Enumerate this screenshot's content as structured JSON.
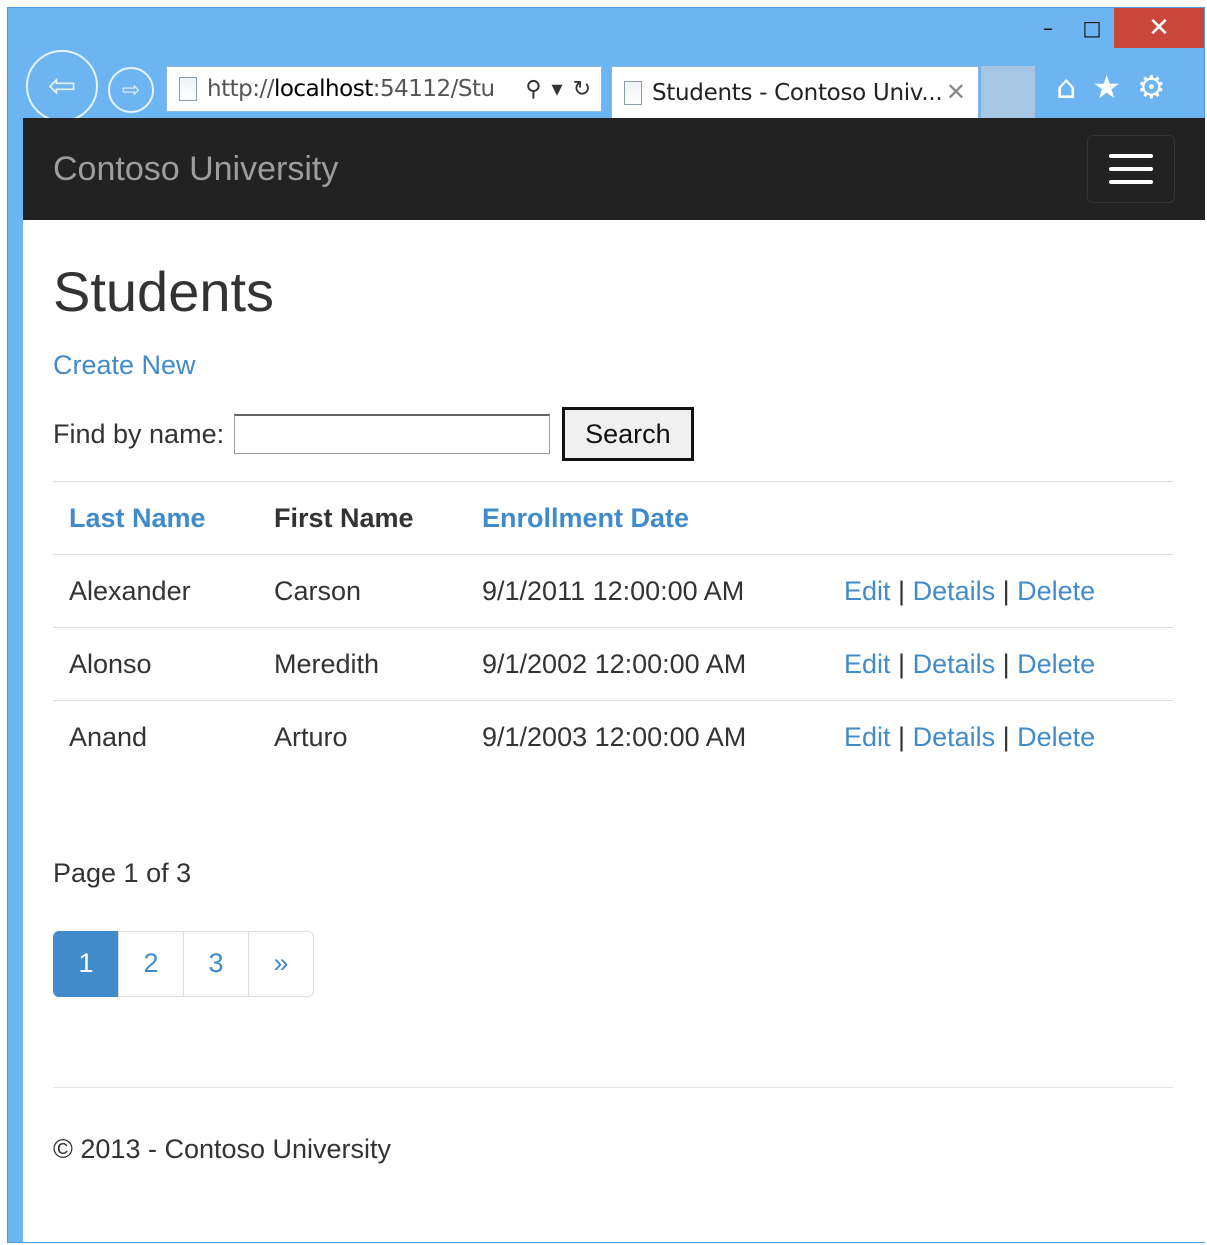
{
  "browser": {
    "url_prefix": "http://",
    "url_host": "localhost",
    "url_rest": ":54112/Stu",
    "tab_title": "Students - Contoso Univ...",
    "minimize": "–",
    "maximize": "□",
    "close": "✕",
    "tab_close": "✕"
  },
  "navbar": {
    "brand": "Contoso University"
  },
  "page": {
    "title": "Students",
    "create_new": "Create New",
    "find_label": "Find by name:",
    "search_value": "",
    "search_button": "Search"
  },
  "table": {
    "headers": {
      "last_name": "Last Name",
      "first_name": "First Name",
      "enrollment_date": "Enrollment Date"
    },
    "rows": [
      {
        "last_name": "Alexander",
        "first_name": "Carson",
        "enrollment_date": "9/1/2011 12:00:00 AM"
      },
      {
        "last_name": "Alonso",
        "first_name": "Meredith",
        "enrollment_date": "9/1/2002 12:00:00 AM"
      },
      {
        "last_name": "Anand",
        "first_name": "Arturo",
        "enrollment_date": "9/1/2003 12:00:00 AM"
      }
    ],
    "actions": {
      "edit": "Edit",
      "details": "Details",
      "delete": "Delete",
      "separator": "|"
    }
  },
  "pager": {
    "text": "Page 1 of 3",
    "pages": [
      "1",
      "2",
      "3",
      "»"
    ],
    "active": "1"
  },
  "footer": {
    "text": "© 2013 - Contoso University"
  },
  "colors": {
    "link": "#428bca",
    "navbar_bg": "#222222",
    "frame": "#6cb4f2",
    "close_btn": "#c9463d"
  }
}
